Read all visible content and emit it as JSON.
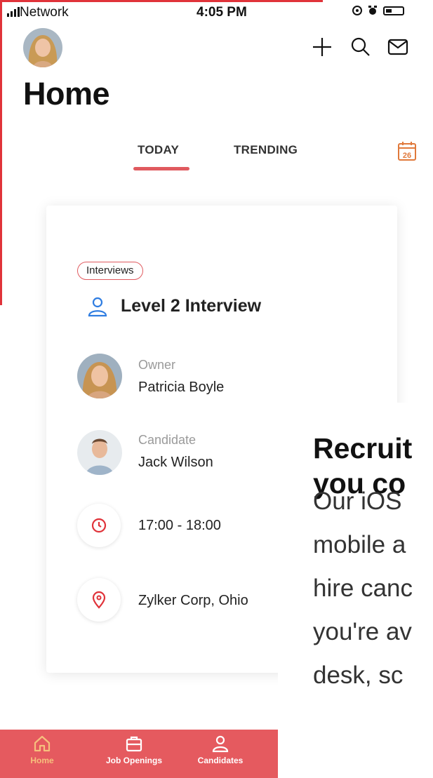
{
  "status_bar": {
    "network": "Network",
    "time": "4:05 PM"
  },
  "header": {
    "title": "Home"
  },
  "tabs": [
    {
      "label": "TODAY"
    },
    {
      "label": "TRENDING"
    }
  ],
  "calendar_day": "26",
  "card": {
    "badge": "Interviews",
    "title": "Level 2 Interview",
    "owner": {
      "label": "Owner",
      "name": "Patricia Boyle"
    },
    "candidate": {
      "label": "Candidate",
      "name": "Jack Wilson"
    },
    "time": "17:00 - 18:00",
    "location": "Zylker Corp, Ohio"
  },
  "promo": {
    "heading": [
      "Recruit",
      "you co"
    ],
    "body": [
      "Our iOS",
      "mobile a",
      "hire canc",
      "you're av",
      "desk, sc"
    ]
  },
  "bottom_nav": [
    {
      "label": "Home"
    },
    {
      "label": "Job Openings"
    },
    {
      "label": "Candidates"
    }
  ],
  "colors": {
    "accent": "#e05a5f",
    "nav_bg": "#e55a5f",
    "icon_blue": "#2f7de1",
    "home_active": "#f6c07d"
  }
}
